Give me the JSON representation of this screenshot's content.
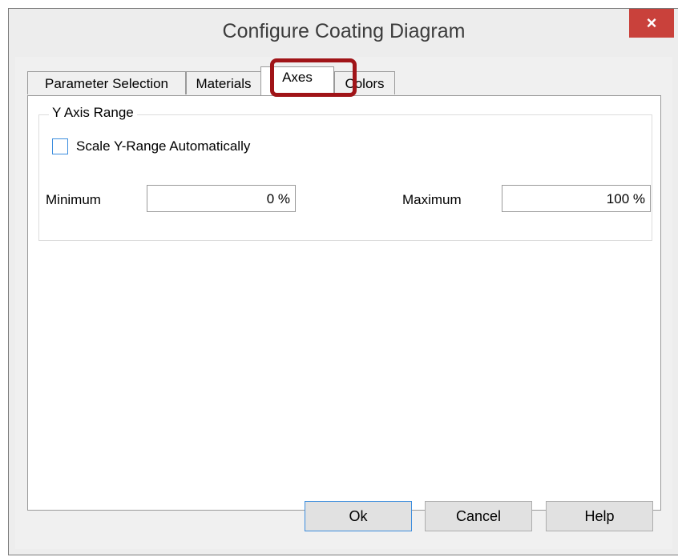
{
  "window": {
    "title": "Configure Coating Diagram",
    "close_label": "×"
  },
  "tabs": [
    {
      "label": "Parameter Selection",
      "active": false
    },
    {
      "label": "Materials",
      "active": false
    },
    {
      "label": "Axes",
      "active": true
    },
    {
      "label": "Colors",
      "active": false
    }
  ],
  "group": {
    "title": "Y Axis Range",
    "auto_scale_label": "Scale Y-Range Automatically",
    "auto_scale_checked": false,
    "minimum_label": "Minimum",
    "minimum_value": "0 %",
    "maximum_label": "Maximum",
    "maximum_value": "100 %"
  },
  "buttons": {
    "ok": "Ok",
    "cancel": "Cancel",
    "help": "Help"
  },
  "colors": {
    "close_button": "#c9413b",
    "highlight": "#a01418",
    "focus": "#3c8dde"
  }
}
